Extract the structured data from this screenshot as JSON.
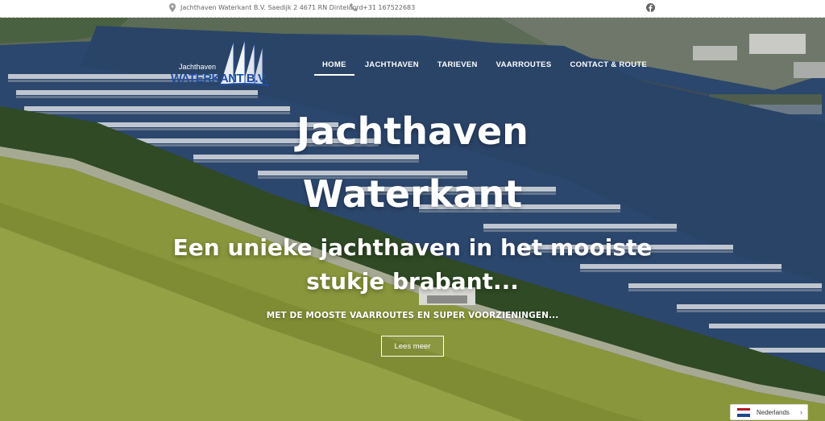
{
  "topbar": {
    "address": "Jachthaven Waterkant B.V. Saedijk 2 4671 RN Dinteloord",
    "phone": "+31 167522683"
  },
  "logo": {
    "small": "Jachthaven",
    "big": "WATERKANT B.V."
  },
  "nav": [
    {
      "label": "HOME",
      "active": true
    },
    {
      "label": "JACHTHAVEN"
    },
    {
      "label": "TARIEVEN"
    },
    {
      "label": "VAARROUTES"
    },
    {
      "label": "CONTACT & ROUTE"
    }
  ],
  "hero": {
    "title_line1": "Jachthaven",
    "title_line2": "Waterkant",
    "tagline_line1": "Een unieke jachthaven in het mooiste",
    "tagline_line2": "stukje brabant...",
    "subtitle": "MET DE MOOSTE VAARROUTES EN SUPER VOORZIENINGEN...",
    "button": "Lees meer"
  },
  "language": {
    "selected": "Nederlands"
  },
  "icons": {
    "address": "location-pin-icon",
    "phone": "phone-icon",
    "social": "facebook-icon",
    "language": "netherlands-flag-icon",
    "dropdown": "chevron-right-icon"
  },
  "colors": {
    "logo_blue": "#1f4ea3",
    "water": "#2b4569",
    "field": "#8e9a3c"
  }
}
